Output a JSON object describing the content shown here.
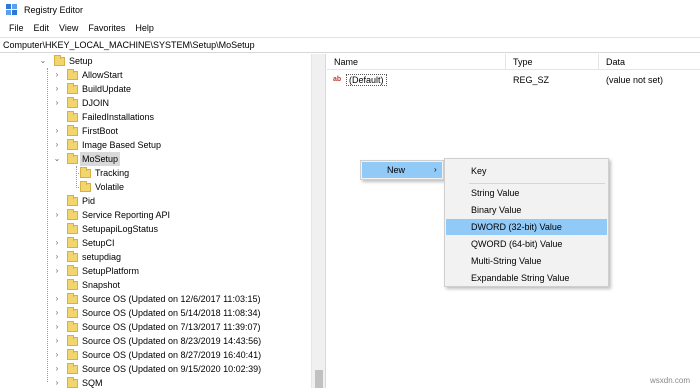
{
  "window": {
    "title": "Registry Editor"
  },
  "menubar": {
    "items": [
      "File",
      "Edit",
      "View",
      "Favorites",
      "Help"
    ]
  },
  "address": {
    "path": "Computer\\HKEY_LOCAL_MACHINE\\SYSTEM\\Setup\\MoSetup"
  },
  "tree": {
    "root": "Setup",
    "children": [
      "AllowStart",
      "BuildUpdate",
      "DJOIN",
      "FailedInstallations",
      "FirstBoot",
      "Image Based Setup",
      "MoSetup",
      "Tracking",
      "Volatile",
      "Pid",
      "Service Reporting API",
      "SetupapiLogStatus",
      "SetupCI",
      "setupdiag",
      "SetupPlatform",
      "Snapshot",
      "Source OS (Updated on 12/6/2017 11:03:15)",
      "Source OS (Updated on 5/14/2018 11:08:34)",
      "Source OS (Updated on 7/13/2017 11:39:07)",
      "Source OS (Updated on 8/23/2019 14:43:56)",
      "Source OS (Updated on 8/27/2019 16:40:41)",
      "Source OS (Updated on 9/15/2020 10:02:39)",
      "SQM"
    ],
    "selected": "MoSetup"
  },
  "list": {
    "columns": [
      "Name",
      "Type",
      "Data"
    ],
    "rows": [
      {
        "icon": "string-value-icon",
        "icon_text": "ab",
        "name": "(Default)",
        "type": "REG_SZ",
        "data": "(value not set)"
      }
    ]
  },
  "context_menu": {
    "new_label": "New",
    "arrow": "›"
  },
  "submenu": {
    "items": [
      "Key",
      "String Value",
      "Binary Value",
      "DWORD (32-bit) Value",
      "QWORD (64-bit) Value",
      "Multi-String Value",
      "Expandable String Value"
    ],
    "highlighted": "DWORD (32-bit) Value"
  },
  "watermark": "wsxdn.com",
  "colors": {
    "highlight": "#91c9f7",
    "folder": "#f3d56f",
    "selected_bg": "#d9d9d9"
  }
}
